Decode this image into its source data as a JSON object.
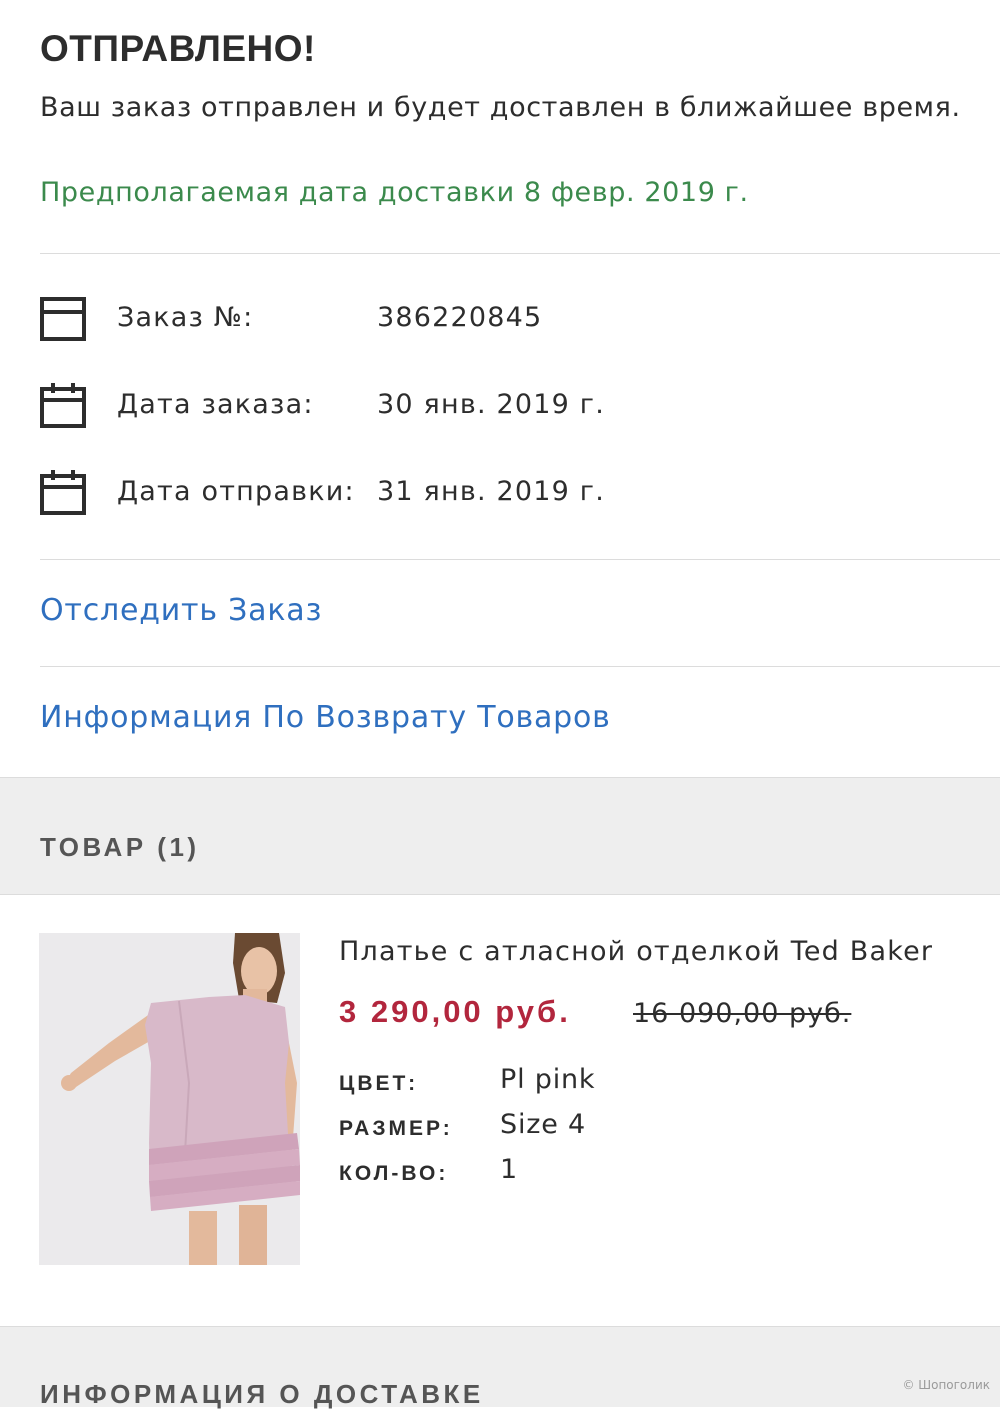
{
  "status": {
    "title": "ОТПРАВЛЕНО!",
    "message": "Ваш заказ отправлен и будет доставлен в ближайшее время.",
    "delivery_estimate": "Предполагаемая дата доставки 8 февр. 2019 г."
  },
  "order_info": [
    {
      "icon": "box-icon",
      "label": "Заказ №:",
      "value": "386220845"
    },
    {
      "icon": "calendar-icon",
      "label": "Дата заказа:",
      "value": "30 янв. 2019 г."
    },
    {
      "icon": "calendar-icon",
      "label": "Дата отправки:",
      "value": "31 янв. 2019 г."
    }
  ],
  "links": {
    "track_order": "Отследить Заказ",
    "returns_info": "Информация По Возврату Товаров"
  },
  "items_section": {
    "title": "ТОВАР (1)"
  },
  "product": {
    "name": "Платье с атласной отделкой Ted Baker",
    "price_current": "3 290,00 руб.",
    "price_old": "16 090,00 руб.",
    "attributes": [
      {
        "label": "ЦВЕТ:",
        "value": "Pl pink"
      },
      {
        "label": "РАЗМЕР:",
        "value": "Size 4"
      },
      {
        "label": "КОЛ-ВО:",
        "value": "1"
      }
    ]
  },
  "delivery_section": {
    "title": "ИНФОРМАЦИЯ О ДОСТАВКЕ"
  },
  "watermark": "© Шопоголик",
  "colors": {
    "accent_green": "#3b8a4c",
    "link_blue": "#2f6fbf",
    "price_red": "#b2263d",
    "section_bg": "#eeeeee"
  }
}
